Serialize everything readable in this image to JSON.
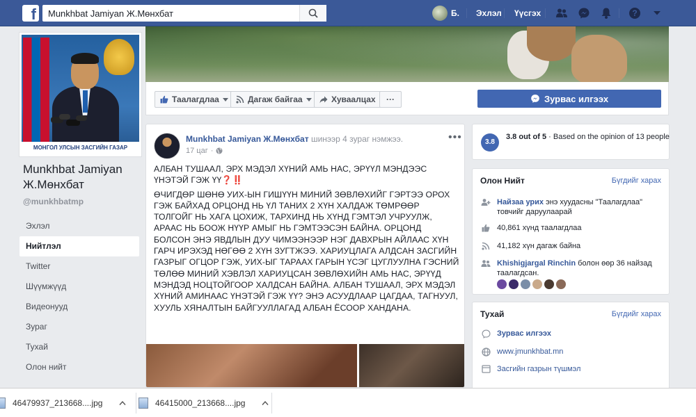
{
  "topbar": {
    "logo": "f",
    "search_value": "Munkhbat Jamiyan Ж.Мөнхбат",
    "user_short": "Б.",
    "nav_home": "Эхлэл",
    "nav_create": "Үүсгэх"
  },
  "sidebar": {
    "page_name": "Munkhbat Jamiyan Ж.Мөнхбат",
    "handle": "@munkhbatmp",
    "photo_caption": "МОНГОЛ УЛСЫН ЗАСГИЙН ГАЗАР",
    "items": [
      {
        "label": "Эхлэл"
      },
      {
        "label": "Нийтлэл"
      },
      {
        "label": "Twitter"
      },
      {
        "label": "Шүүмжүүд"
      },
      {
        "label": "Видеонууд"
      },
      {
        "label": "Зураг"
      },
      {
        "label": "Тухай"
      },
      {
        "label": "Олон нийт"
      }
    ]
  },
  "actions": {
    "like": "Таалагдлаа",
    "follow": "Дагаж байгаа",
    "share": "Хуваалцах",
    "more": "···",
    "message": "Зурвас илгээх"
  },
  "post": {
    "author": "Munkhbat Jamiyan Ж.Мөнхбат",
    "added": "шинээр 4 зураг нэмжээ.",
    "time": "17 цаг",
    "more": "•••",
    "headline": "АЛБАН ТУШААЛ, ЭРХ МЭДЭЛ ХҮНИЙ АМЬ НАС, ЭРҮҮЛ МЭНДЭЭС ҮНЭТЭЙ ГЭЖ ҮҮ❓‼️",
    "body": "ӨЧИГДӨР ШӨНӨ УИХ-ЫН ГИШҮҮН МИНИЙ ЗӨВЛӨХИЙГ ГЭРТЭЭ ОРОХ ГЭЖ БАЙХАД ОРЦОНД НЬ ҮЛ ТАНИХ 2 ХҮН ХАЛДАЖ ТӨМРӨӨР ТОЛГОЙГ НЬ ХАГА ЦОХИЖ, ТАРХИНД НЬ ХҮНД ГЭМТЭЛ УЧРУУЛЖ, АРААС НЬ БООЖ НҮҮР АМЫГ НЬ ГЭМТЭЭСЭН БАЙНА. ОРЦОНД БОЛСОН ЭНЭ ЯВДЛЫН ДУУ ЧИМЭЭНЭЭР НЭГ ДАВХРЫН АЙЛААС ХҮН ГАРЧ ИРЭХЭД НӨГӨӨ 2 ХҮН ЗУГТЖЭЭ. ХАРИУЦЛАГА АЛДСАН ЗАСГИЙН ГАЗРЫГ ОГЦОР ГЭЖ, УИХ-ЫГ ТАРААХ ГАРЫН ҮСЭГ ЦУГЛУУЛНА ГЭСНИЙ ТӨЛӨӨ МИНИЙ ХЭВЛЭЛ ХАРИУЦСАН ЗӨВЛӨХИЙН АМЬ НАС, ЭРҮҮД МЭНДЭД НОЦТОЙГООР ХАЛДСАН БАЙНА. АЛБАН ТУШААЛ, ЭРХ МЭДЭЛ ХҮНИЙ АМИНААС ҮНЭТЭЙ ГЭЖ ҮҮ? ЭНЭ АСУУДЛААР ЦАГДАА, ТАГНУУЛ, ХУУЛЬ ХЯНАЛТЫН БАЙГУУЛЛАГАД АЛБАН ЁСООР ХАНДАНА."
  },
  "rating": {
    "score": "3.8",
    "score_text": "3.8 out of 5",
    "basis": "Based on the opinion of 13 people"
  },
  "community": {
    "title": "Олон Нийт",
    "see_all": "Бүгдийг харах",
    "invite_link": "Найзаа урих",
    "invite_rest": "энэ хуудасны \"Таалагдлаа\" товчийг даруулаарай",
    "likes": "40,861 хүнд таалагдлаа",
    "follows": "41,182 хүн дагаж байна",
    "friend_name": "Khishigjargal Rinchin",
    "friend_rest": "болон өөр 36 найзад таалагдсан."
  },
  "about": {
    "title": "Тухай",
    "see_all": "Бүгдийг харах",
    "message": "Зурвас илгээх",
    "website": "www.jmunkhbat.mn",
    "category": "Засгийн газрын түшмэл"
  },
  "downloads": [
    {
      "name": "46479937_213668....jpg"
    },
    {
      "name": "46415000_213668....jpg"
    }
  ]
}
